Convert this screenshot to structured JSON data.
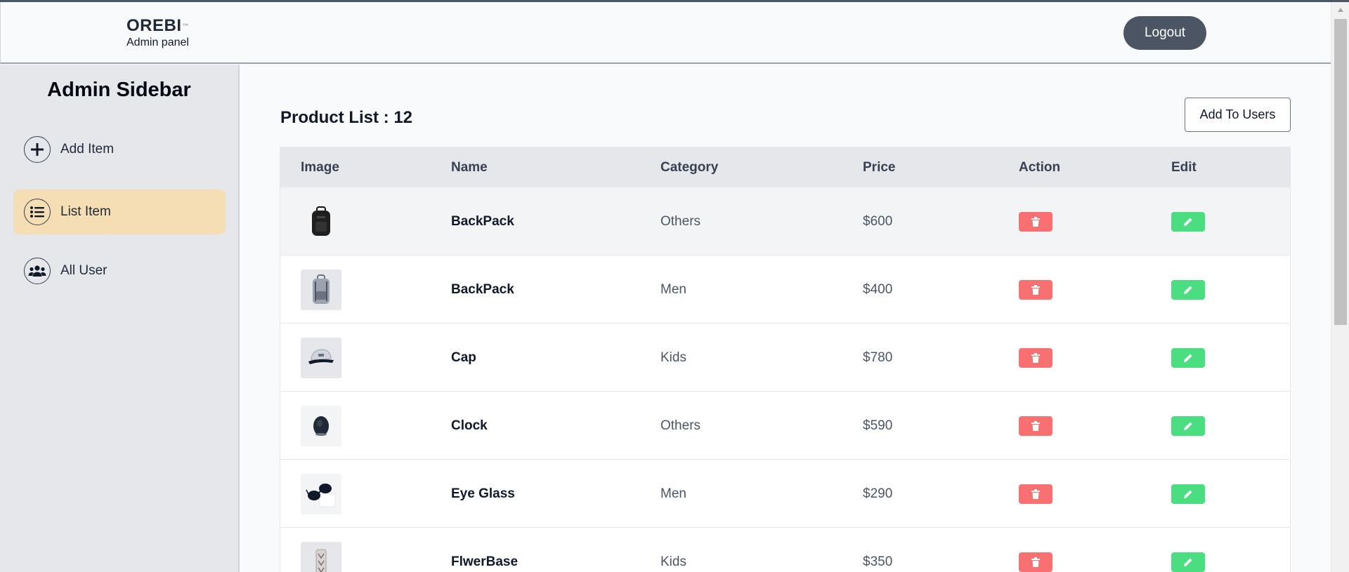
{
  "header": {
    "brand_name": "OREBI",
    "brand_mark": "™",
    "brand_subtitle": "Admin panel",
    "logout_label": "Logout"
  },
  "sidebar": {
    "title": "Admin Sidebar",
    "items": [
      {
        "label": "Add Item",
        "icon": "plus-circle-icon",
        "active": false
      },
      {
        "label": "List Item",
        "icon": "list-icon",
        "active": true
      },
      {
        "label": "All User",
        "icon": "users-icon",
        "active": false
      }
    ]
  },
  "main": {
    "title": "Product List : 12",
    "add_users_label": "Add To Users",
    "table": {
      "columns": [
        "Image",
        "Name",
        "Category",
        "Price",
        "Action",
        "Edit"
      ],
      "rows": [
        {
          "image": "backpack-black-icon",
          "name": "BackPack",
          "category": "Others",
          "price": "$600"
        },
        {
          "image": "backpack-grey-icon",
          "name": "BackPack",
          "category": "Men",
          "price": "$400"
        },
        {
          "image": "cap-icon",
          "name": "Cap",
          "category": "Kids",
          "price": "$780"
        },
        {
          "image": "clock-icon",
          "name": "Clock",
          "category": "Others",
          "price": "$590"
        },
        {
          "image": "eyeglass-icon",
          "name": "Eye Glass",
          "category": "Men",
          "price": "$290"
        },
        {
          "image": "flower-vase-icon",
          "name": "FlwerBase",
          "category": "Kids",
          "price": "$350"
        }
      ]
    }
  },
  "colors": {
    "header_bg": "#f9fafb",
    "logout_bg": "#4b5563",
    "sidebar_bg": "#e5e7eb",
    "active_item_bg": "#f5deb3",
    "delete_button": "#f87171",
    "edit_button": "#4ade80",
    "table_header_bg": "#e5e7eb"
  }
}
